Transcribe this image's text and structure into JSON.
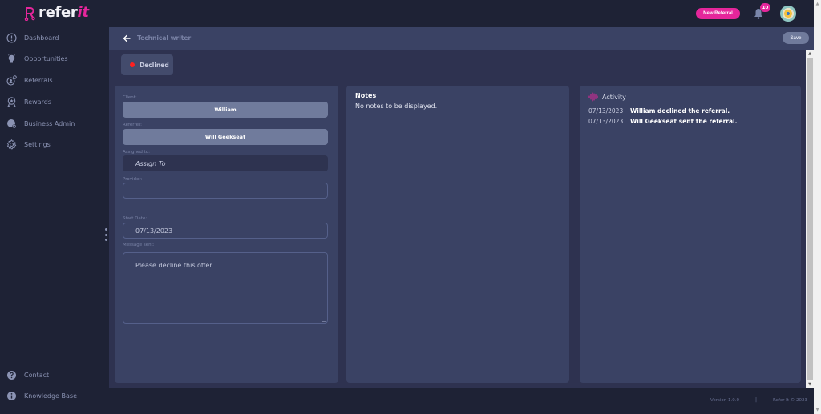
{
  "app": {
    "brand_main": "refer",
    "brand_accent": "it",
    "brand_color": "#e5269b"
  },
  "topbar": {
    "new_referral_label": "New Referral",
    "notification_count": "10",
    "notification_icon": "bell-icon",
    "avatar_icon": "user-avatar"
  },
  "sidebar": {
    "items": [
      {
        "label": "Dashboard",
        "icon": "dashboard-icon"
      },
      {
        "label": "Opportunities",
        "icon": "lightbulb-icon"
      },
      {
        "label": "Referrals",
        "icon": "referrals-icon"
      },
      {
        "label": "Rewards",
        "icon": "award-icon"
      },
      {
        "label": "Business Admin",
        "icon": "business-admin-icon"
      },
      {
        "label": "Settings",
        "icon": "gear-icon"
      }
    ],
    "bottom_items": [
      {
        "label": "Contact",
        "icon": "question-icon"
      },
      {
        "label": "Knowledge Base",
        "icon": "info-icon"
      }
    ]
  },
  "header": {
    "title": "Technical writer",
    "save_label": "Save"
  },
  "status": {
    "label": "Declined",
    "color": "#ff2020"
  },
  "form": {
    "client_label": "Client:",
    "client_value": "William",
    "referrer_label": "Referrer:",
    "referrer_value": "Will Geekseat",
    "assigned_label": "Assigned to:",
    "assigned_placeholder": "Assign To",
    "provider_label": "Provider:",
    "provider_value": "",
    "start_date_label": "Start Date:",
    "start_date_value": "07/13/2023",
    "message_label": "Message sent:",
    "message_value": "Please decline this offer"
  },
  "notes": {
    "title": "Notes",
    "empty_text": "No notes to be displayed."
  },
  "activity": {
    "title": "Activity",
    "entries": [
      {
        "date": "07/13/2023",
        "text": "William declined the referral."
      },
      {
        "date": "07/13/2023",
        "text": "Will Geekseat sent the referral."
      }
    ]
  },
  "footer": {
    "version": "Version 1.0.0",
    "separator": "|",
    "copyright": "Refer-It © 2023"
  }
}
